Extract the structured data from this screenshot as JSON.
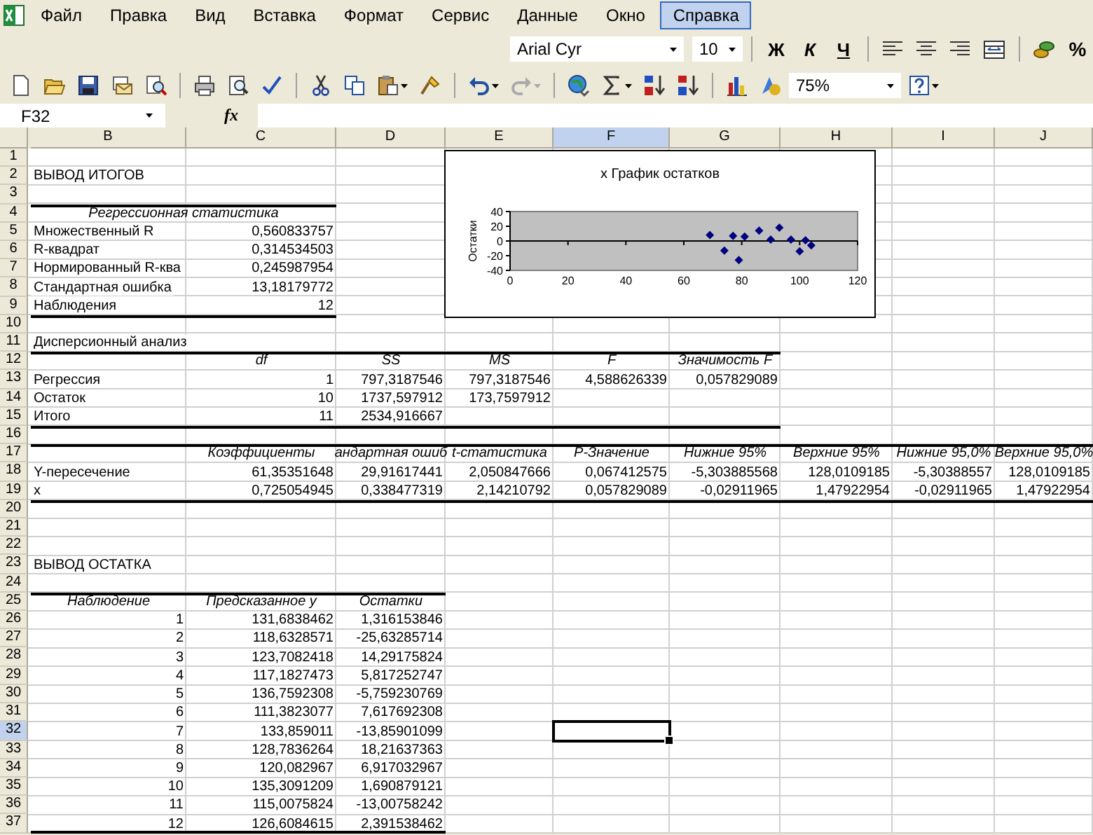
{
  "menu": [
    {
      "label": "Файл",
      "selected": false
    },
    {
      "label": "Правка",
      "selected": false
    },
    {
      "label": "Вид",
      "selected": false
    },
    {
      "label": "Вставка",
      "selected": false
    },
    {
      "label": "Формат",
      "selected": false
    },
    {
      "label": "Сервис",
      "selected": false
    },
    {
      "label": "Данные",
      "selected": false
    },
    {
      "label": "Окно",
      "selected": false
    },
    {
      "label": "Справка",
      "selected": true
    }
  ],
  "format_toolbar": {
    "font": "Arial Cyr",
    "size": "10",
    "style_buttons": [
      "Ж",
      "К",
      "Ч"
    ],
    "percent": "%"
  },
  "standard_toolbar": {
    "zoom": "75%",
    "redo_disabled": true
  },
  "formula_bar": {
    "name_box": "F32",
    "function_label": "fx"
  },
  "sheet": {
    "columns": [
      {
        "letter": "B",
        "selected": false
      },
      {
        "letter": "C",
        "selected": false
      },
      {
        "letter": "D",
        "selected": false
      },
      {
        "letter": "E",
        "selected": false
      },
      {
        "letter": "F",
        "selected": true
      },
      {
        "letter": "G",
        "selected": false
      },
      {
        "letter": "H",
        "selected": false
      },
      {
        "letter": "I",
        "selected": false
      },
      {
        "letter": "J",
        "selected": false
      }
    ],
    "rows": [
      {
        "header": "1",
        "selected": false,
        "cells": []
      },
      {
        "header": "2",
        "selected": false,
        "cells": [
          {
            "text": "ВЫВОД ИТОГОВ",
            "kind": "text"
          }
        ]
      },
      {
        "header": "3",
        "selected": false,
        "cells": []
      },
      {
        "header": "4",
        "selected": false,
        "cells": [
          {
            "text": "Регрессионная статистика",
            "kind": "banner",
            "rule_top": true
          }
        ]
      },
      {
        "header": "5",
        "selected": false,
        "cells": [
          {
            "text": "Множественный R",
            "kind": "text"
          },
          {
            "text": "0,560833757",
            "kind": "number"
          }
        ]
      },
      {
        "header": "6",
        "selected": false,
        "cells": [
          {
            "text": "R-квадрат",
            "kind": "text"
          },
          {
            "text": "0,314534503",
            "kind": "number"
          }
        ]
      },
      {
        "header": "7",
        "selected": false,
        "cells": [
          {
            "text": "Нормированный R-ква",
            "kind": "text"
          },
          {
            "text": "0,245987954",
            "kind": "number"
          }
        ]
      },
      {
        "header": "8",
        "selected": false,
        "cells": [
          {
            "text": "Стандартная ошибка",
            "kind": "text"
          },
          {
            "text": "13,18179772",
            "kind": "number"
          }
        ]
      },
      {
        "header": "9",
        "selected": false,
        "cells": [
          {
            "text": "Наблюдения",
            "kind": "text"
          },
          {
            "text": "12",
            "kind": "number"
          }
        ]
      },
      {
        "header": "10",
        "selected": false,
        "cells": [
          {
            "rule_top": true
          },
          {
            "rule_top": true
          }
        ]
      },
      {
        "header": "11",
        "selected": false,
        "cells": [
          {
            "text": "Дисперсионный анализ",
            "kind": "text"
          }
        ]
      },
      {
        "header": "12",
        "selected": false,
        "cells": [
          {
            "rule_top": true
          },
          {
            "text": "df",
            "kind": "header",
            "rule_top": true
          },
          {
            "text": "SS",
            "kind": "header",
            "rule_top": true
          },
          {
            "text": "MS",
            "kind": "header",
            "rule_top": true
          },
          {
            "text": "F",
            "kind": "header",
            "rule_top": true
          },
          {
            "text": "Значимость F",
            "kind": "header",
            "rule_top": true
          }
        ]
      },
      {
        "header": "13",
        "selected": false,
        "cells": [
          {
            "text": "Регрессия",
            "kind": "text"
          },
          {
            "text": "1",
            "kind": "number"
          },
          {
            "text": "797,3187546",
            "kind": "number"
          },
          {
            "text": "797,3187546",
            "kind": "number"
          },
          {
            "text": "4,588626339",
            "kind": "number"
          },
          {
            "text": "0,057829089",
            "kind": "number"
          }
        ]
      },
      {
        "header": "14",
        "selected": false,
        "cells": [
          {
            "text": "Остаток",
            "kind": "text"
          },
          {
            "text": "10",
            "kind": "number"
          },
          {
            "text": "1737,597912",
            "kind": "number"
          },
          {
            "text": "173,7597912",
            "kind": "number"
          }
        ]
      },
      {
        "header": "15",
        "selected": false,
        "cells": [
          {
            "text": "Итого",
            "kind": "text"
          },
          {
            "text": "11",
            "kind": "number"
          },
          {
            "text": "2534,916667",
            "kind": "number"
          }
        ]
      },
      {
        "header": "16",
        "selected": false,
        "cells": [
          {
            "rule_top": true
          },
          {
            "rule_top": true
          },
          {
            "rule_top": true
          },
          {
            "rule_top": true
          },
          {
            "rule_top": true
          },
          {
            "rule_top": true
          }
        ]
      },
      {
        "header": "17",
        "selected": false,
        "cells": [
          {
            "rule_top": true
          },
          {
            "text": "Коэффициенты",
            "kind": "header",
            "rule_top": true
          },
          {
            "text": "андартная ошиб",
            "kind": "header",
            "rule_top": true
          },
          {
            "text": "t-статистика",
            "kind": "header",
            "rule_top": true
          },
          {
            "text": "P-Значение",
            "kind": "header",
            "rule_top": true
          },
          {
            "text": "Нижние 95%",
            "kind": "header",
            "rule_top": true
          },
          {
            "text": "Верхние 95%",
            "kind": "header",
            "rule_top": true
          },
          {
            "text": "Нижние 95,0%",
            "kind": "header",
            "rule_top": true
          },
          {
            "text": "Верхние 95,0%",
            "kind": "header",
            "rule_top": true
          }
        ]
      },
      {
        "header": "18",
        "selected": false,
        "cells": [
          {
            "text": "Y-пересечение",
            "kind": "text"
          },
          {
            "text": "61,35351648",
            "kind": "number"
          },
          {
            "text": "29,91617441",
            "kind": "number"
          },
          {
            "text": "2,050847666",
            "kind": "number"
          },
          {
            "text": "0,067412575",
            "kind": "number"
          },
          {
            "text": "-5,303885568",
            "kind": "number"
          },
          {
            "text": "128,0109185",
            "kind": "number"
          },
          {
            "text": "-5,30388557",
            "kind": "number"
          },
          {
            "text": "128,0109185",
            "kind": "number"
          }
        ]
      },
      {
        "header": "19",
        "selected": false,
        "cells": [
          {
            "text": "x",
            "kind": "text"
          },
          {
            "text": "0,725054945",
            "kind": "number"
          },
          {
            "text": "0,338477319",
            "kind": "number"
          },
          {
            "text": "2,14210792",
            "kind": "number"
          },
          {
            "text": "0,057829089",
            "kind": "number"
          },
          {
            "text": "-0,02911965",
            "kind": "number"
          },
          {
            "text": "1,47922954",
            "kind": "number"
          },
          {
            "text": "-0,02911965",
            "kind": "number"
          },
          {
            "text": "1,47922954",
            "kind": "number"
          }
        ]
      },
      {
        "header": "20",
        "selected": false,
        "cells": [
          {
            "rule_top": true
          },
          {
            "rule_top": true
          },
          {
            "rule_top": true
          },
          {
            "rule_top": true
          },
          {
            "rule_top": true
          },
          {
            "rule_top": true
          },
          {
            "rule_top": true
          },
          {
            "rule_top": true
          },
          {
            "rule_top": true
          }
        ]
      },
      {
        "header": "21",
        "selected": false,
        "cells": []
      },
      {
        "header": "22",
        "selected": false,
        "cells": []
      },
      {
        "header": "23",
        "selected": false,
        "cells": [
          {
            "text": "ВЫВОД ОСТАТКА",
            "kind": "text"
          }
        ]
      },
      {
        "header": "24",
        "selected": false,
        "cells": []
      },
      {
        "header": "25",
        "selected": false,
        "cells": [
          {
            "text": "Наблюдение",
            "kind": "header",
            "rule_top": true
          },
          {
            "text": "Предсказанное y",
            "kind": "header",
            "rule_top": true
          },
          {
            "text": "Остатки",
            "kind": "header",
            "rule_top": true
          }
        ]
      },
      {
        "header": "26",
        "selected": false,
        "cells": [
          {
            "text": "1",
            "kind": "number"
          },
          {
            "text": "131,6838462",
            "kind": "number"
          },
          {
            "text": "1,316153846",
            "kind": "number"
          }
        ]
      },
      {
        "header": "27",
        "selected": false,
        "cells": [
          {
            "text": "2",
            "kind": "number"
          },
          {
            "text": "118,6328571",
            "kind": "number"
          },
          {
            "text": "-25,63285714",
            "kind": "number"
          }
        ]
      },
      {
        "header": "28",
        "selected": false,
        "cells": [
          {
            "text": "3",
            "kind": "number"
          },
          {
            "text": "123,7082418",
            "kind": "number"
          },
          {
            "text": "14,29175824",
            "kind": "number"
          }
        ]
      },
      {
        "header": "29",
        "selected": false,
        "cells": [
          {
            "text": "4",
            "kind": "number"
          },
          {
            "text": "117,1827473",
            "kind": "number"
          },
          {
            "text": "5,817252747",
            "kind": "number"
          }
        ]
      },
      {
        "header": "30",
        "selected": false,
        "cells": [
          {
            "text": "5",
            "kind": "number"
          },
          {
            "text": "136,7592308",
            "kind": "number"
          },
          {
            "text": "-5,759230769",
            "kind": "number"
          }
        ]
      },
      {
        "header": "31",
        "selected": false,
        "cells": [
          {
            "text": "6",
            "kind": "number"
          },
          {
            "text": "111,3823077",
            "kind": "number"
          },
          {
            "text": "7,617692308",
            "kind": "number"
          }
        ]
      },
      {
        "header": "32",
        "selected": true,
        "cells": [
          {
            "text": "7",
            "kind": "number"
          },
          {
            "text": "133,859011",
            "kind": "number"
          },
          {
            "text": "-13,85901099",
            "kind": "number"
          }
        ]
      },
      {
        "header": "33",
        "selected": false,
        "cells": [
          {
            "text": "8",
            "kind": "number"
          },
          {
            "text": "128,7836264",
            "kind": "number"
          },
          {
            "text": "18,21637363",
            "kind": "number"
          }
        ]
      },
      {
        "header": "34",
        "selected": false,
        "cells": [
          {
            "text": "9",
            "kind": "number"
          },
          {
            "text": "120,082967",
            "kind": "number"
          },
          {
            "text": "6,917032967",
            "kind": "number"
          }
        ]
      },
      {
        "header": "35",
        "selected": false,
        "cells": [
          {
            "text": "10",
            "kind": "number"
          },
          {
            "text": "135,3091209",
            "kind": "number"
          },
          {
            "text": "1,690879121",
            "kind": "number"
          }
        ]
      },
      {
        "header": "36",
        "selected": false,
        "cells": [
          {
            "text": "11",
            "kind": "number"
          },
          {
            "text": "115,0075824",
            "kind": "number"
          },
          {
            "text": "-13,00758242",
            "kind": "number"
          }
        ]
      },
      {
        "header": "37",
        "selected": false,
        "cells": [
          {
            "text": "12",
            "kind": "number",
            "rule_bottom": true
          },
          {
            "text": "126,6084615",
            "kind": "number",
            "rule_bottom": true
          },
          {
            "text": "2,391538462",
            "kind": "number",
            "rule_bottom": true
          }
        ]
      }
    ],
    "chart": {
      "chart_data": {
        "type": "scatter",
        "title": "x График остатков",
        "ylabel": "Остатки",
        "x": [
          69,
          74,
          77,
          79,
          81,
          86,
          90,
          93,
          97,
          100,
          102,
          104
        ],
        "series": [
          {
            "color": "#000080",
            "values": [
              8,
              -13,
              7,
              -26,
              6,
              14,
              2,
              18,
              2,
              -14,
              1,
              -6
            ]
          }
        ],
        "xlim": [
          0,
          120
        ],
        "ylim": [
          -40,
          40
        ],
        "xticks": [
          0,
          20,
          40,
          60,
          80,
          100,
          120
        ],
        "yticks": [
          -40,
          -20,
          0,
          20,
          40
        ]
      }
    }
  }
}
